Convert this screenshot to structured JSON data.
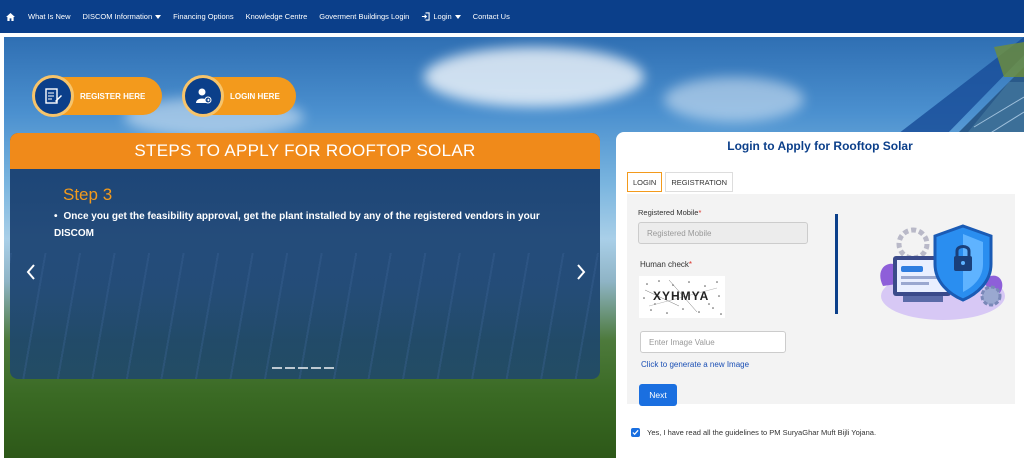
{
  "nav": {
    "home_icon": "home-icon",
    "items": [
      {
        "label": "What Is New",
        "dropdown": false
      },
      {
        "label": "DISCOM Information",
        "dropdown": true
      },
      {
        "label": "Financing Options",
        "dropdown": false
      },
      {
        "label": "Knowledge Centre",
        "dropdown": false
      },
      {
        "label": "Goverment Buildings Login",
        "dropdown": false
      },
      {
        "label": "Login",
        "dropdown": true,
        "icon": "login-icon"
      },
      {
        "label": "Contact Us",
        "dropdown": false
      }
    ]
  },
  "hero": {
    "register_label": "REGISTER HERE",
    "login_label": "LOGIN HERE"
  },
  "steps": {
    "heading": "STEPS TO APPLY FOR ROOFTOP SOLAR",
    "step_title": "Step 3",
    "step_text": "Once you get the feasibility approval, get the plant installed by any of the registered vendors in your DISCOM",
    "prev_icon": "chevron-left-icon",
    "next_icon": "chevron-right-icon",
    "indicator_count": 5
  },
  "login": {
    "title": "Login to Apply for Rooftop Solar",
    "tabs": [
      {
        "label": "LOGIN",
        "active": true
      },
      {
        "label": "REGISTRATION",
        "active": false
      }
    ],
    "mobile_label": "Registered Mobile",
    "mobile_placeholder": "Registered Mobile",
    "human_check_label": "Human check",
    "captcha_text": "XYHMYA",
    "image_placeholder": "Enter Image Value",
    "regenerate_label": "Click to generate a new Image",
    "next_label": "Next",
    "agree_label": "Yes, I have read all the guidelines to PM SuryaGhar Muft Bijli Yojana.",
    "agree_checked": true
  },
  "colors": {
    "nav_bg": "#0b3f8a",
    "accent_orange": "#f39a1c",
    "primary_blue": "#1a6fe0"
  }
}
